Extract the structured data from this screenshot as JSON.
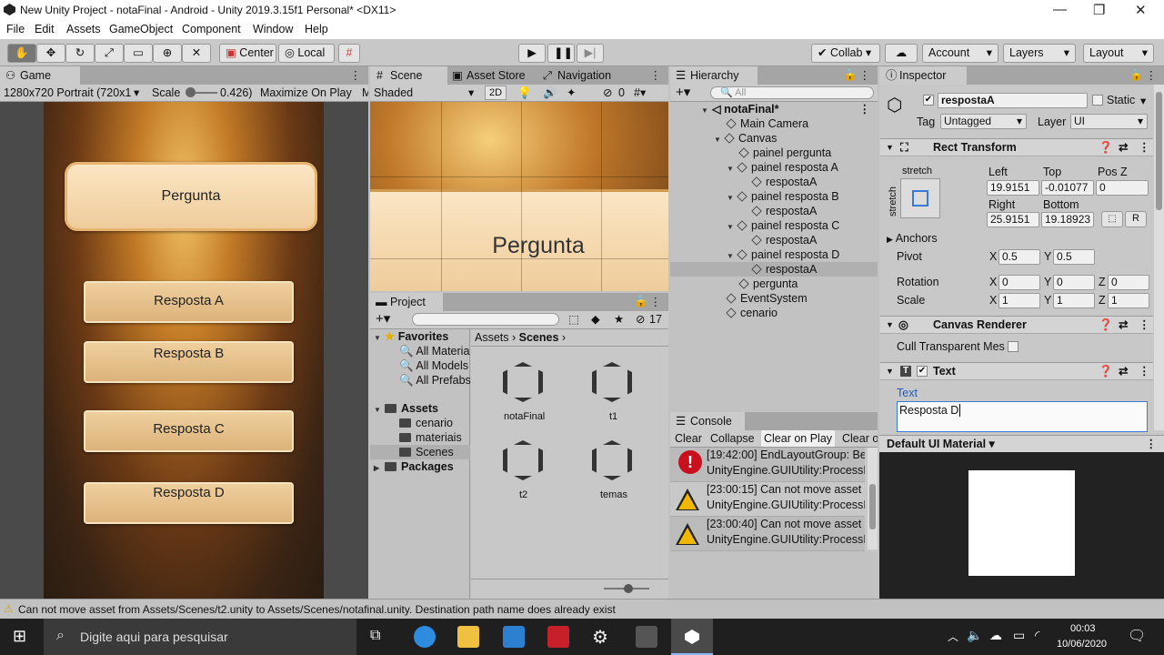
{
  "window": {
    "title": "New Unity Project - notaFinal - Android - Unity 2019.3.15f1 Personal* <DX11>",
    "min": "—",
    "max": "❐",
    "close": "✕"
  },
  "menu": [
    "File",
    "Edit",
    "Assets",
    "GameObject",
    "Component",
    "Window",
    "Help"
  ],
  "toolbar": {
    "center": "Center",
    "local": "Local",
    "collab": "Collab",
    "account": "Account",
    "layers": "Layers",
    "layout": "Layout"
  },
  "game": {
    "tab": "Game",
    "resolution": "1280x720 Portrait (720x1",
    "scale_label": "Scale",
    "scale_value": "0.426)",
    "maximize": "Maximize On Play",
    "m": "M",
    "pergunta": "Pergunta",
    "answers": [
      "Resposta A",
      "Resposta B",
      "Resposta C",
      "Resposta D"
    ]
  },
  "scene": {
    "tab": "Scene",
    "asset_store": "Asset Store",
    "navigation": "Navigation",
    "shaded": "Shaded",
    "twod": "2D",
    "hidden_count": "0",
    "pergunta": "Pergunta"
  },
  "project": {
    "tab": "Project",
    "count": "17",
    "favorites": "Favorites",
    "fav_items": [
      "All Materia",
      "All Models",
      "All Prefabs"
    ],
    "assets": "Assets",
    "asset_items": [
      "cenario",
      "materiais",
      "Scenes"
    ],
    "packages": "Packages",
    "crumb1": "Assets",
    "crumb2": "Scenes",
    "files": [
      "notaFinal",
      "t1",
      "t2",
      "temas"
    ]
  },
  "hierarchy": {
    "tab": "Hierarchy",
    "search_placeholder": "All",
    "scene": "notaFinal*",
    "items": [
      "Main Camera",
      "Canvas",
      "painel pergunta",
      "painel resposta A",
      "respostaA",
      "painel resposta B",
      "respostaA",
      "painel resposta C",
      "respostaA",
      "painel resposta D",
      "respostaA",
      "pergunta",
      "EventSystem",
      "cenario"
    ]
  },
  "console": {
    "tab": "Console",
    "clear": "Clear",
    "collapse": "Collapse",
    "clear_on_play": "Clear on Play",
    "clear_o": "Clear o",
    "rows": [
      {
        "l1": "[19:42:00] EndLayoutGroup: Be",
        "l2": "UnityEngine.GUIUtility:ProcessI"
      },
      {
        "l1": "[23:00:15] Can not move asset",
        "l2": "UnityEngine.GUIUtility:ProcessI"
      },
      {
        "l1": "[23:00:40] Can not move asset",
        "l2": "UnityEngine.GUIUtility:ProcessI"
      }
    ]
  },
  "inspector": {
    "tab": "Inspector",
    "name": "respostaA",
    "static": "Static",
    "tag_label": "Tag",
    "tag": "Untagged",
    "layer_label": "Layer",
    "layer": "UI",
    "rect": "Rect Transform",
    "stretch": "stretch",
    "left_l": "Left",
    "top_l": "Top",
    "posz_l": "Pos Z",
    "left": "19.9151",
    "top": "-0.01077",
    "posz": "0",
    "right_l": "Right",
    "bottom_l": "Bottom",
    "right": "25.9151",
    "bottom": "19.18923",
    "r": "R",
    "anchors": "Anchors",
    "pivot": "Pivot",
    "px": "0.5",
    "py": "0.5",
    "rotation": "Rotation",
    "rx": "0",
    "ry": "0",
    "rz": "0",
    "scale": "Scale",
    "sx": "1",
    "sy": "1",
    "sz": "1",
    "x": "X",
    "y": "Y",
    "z": "Z",
    "canvas_renderer": "Canvas Renderer",
    "cull": "Cull Transparent Mes",
    "text_comp": "Text",
    "text_label": "Text",
    "text_value": "Resposta D",
    "material": "Default UI Material"
  },
  "status": "Can not move asset from Assets/Scenes/t2.unity to Assets/Scenes/notafinal.unity. Destination path name does already exist",
  "taskbar": {
    "search": "Digite aqui para pesquisar",
    "time": "00:03",
    "date": "10/06/2020"
  }
}
